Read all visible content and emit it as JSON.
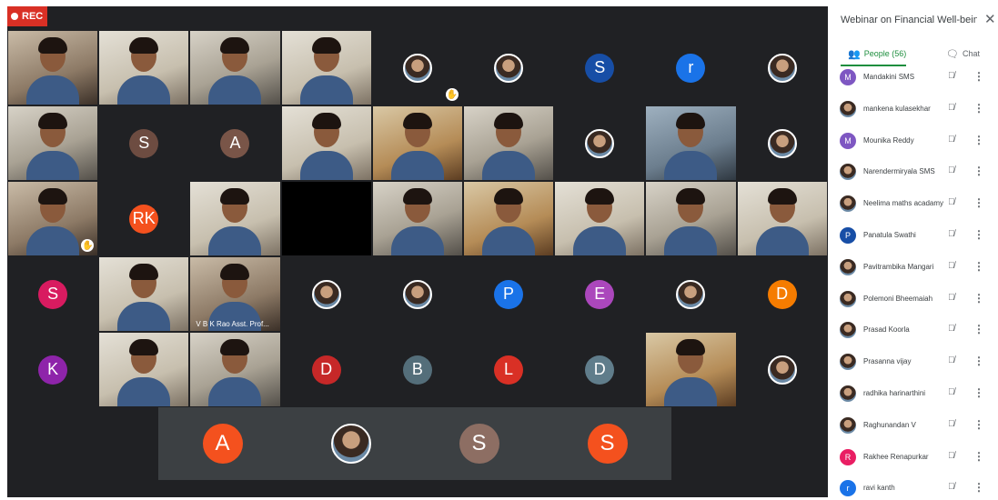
{
  "recording": {
    "label": "REC",
    "color": "#d93025"
  },
  "meeting": {
    "title": "Webinar on Financial Well-being ...",
    "close_icon": "close-icon"
  },
  "tabs": {
    "people_label": "People (56)",
    "chat_label": "Chat",
    "active_color": "#1e8e3e"
  },
  "tiles": [
    {
      "kind": "video",
      "v": "v1"
    },
    {
      "kind": "video",
      "v": "v3"
    },
    {
      "kind": "video",
      "v": "v2"
    },
    {
      "kind": "video",
      "v": "v3"
    },
    {
      "kind": "photo",
      "hand": true
    },
    {
      "kind": "photo"
    },
    {
      "kind": "letter",
      "letter": "S",
      "color": "#174ea6"
    },
    {
      "kind": "letter",
      "letter": "r",
      "color": "#1a73e8"
    },
    {
      "kind": "photo"
    },
    {
      "kind": "video",
      "v": "v2"
    },
    {
      "kind": "letter",
      "letter": "S",
      "color": "#6d4c41"
    },
    {
      "kind": "letter",
      "letter": "A",
      "color": "#795548"
    },
    {
      "kind": "video",
      "v": "v3"
    },
    {
      "kind": "video",
      "v": "v5"
    },
    {
      "kind": "video",
      "v": "v2"
    },
    {
      "kind": "photo"
    },
    {
      "kind": "video",
      "v": "v4"
    },
    {
      "kind": "photo"
    },
    {
      "kind": "video",
      "v": "v1",
      "hand": true
    },
    {
      "kind": "letter",
      "letter": "RK",
      "color": "#f4511e"
    },
    {
      "kind": "video",
      "v": "v3"
    },
    {
      "kind": "black"
    },
    {
      "kind": "video",
      "v": "v2"
    },
    {
      "kind": "video",
      "v": "v5"
    },
    {
      "kind": "video",
      "v": "v3"
    },
    {
      "kind": "video",
      "v": "v2"
    },
    {
      "kind": "video",
      "v": "v3"
    },
    {
      "kind": "letter",
      "letter": "S",
      "color": "#d81b60"
    },
    {
      "kind": "video",
      "v": "v3"
    },
    {
      "kind": "video",
      "v": "v1",
      "name": "V B K Rao Asst. Prof..."
    },
    {
      "kind": "photo"
    },
    {
      "kind": "photo"
    },
    {
      "kind": "letter",
      "letter": "P",
      "color": "#1a73e8"
    },
    {
      "kind": "letter",
      "letter": "E",
      "color": "#ab47bc"
    },
    {
      "kind": "photo"
    },
    {
      "kind": "letter",
      "letter": "D",
      "color": "#f57c00"
    },
    {
      "kind": "letter",
      "letter": "K",
      "color": "#8e24aa"
    },
    {
      "kind": "video",
      "v": "v3"
    },
    {
      "kind": "video",
      "v": "v2"
    },
    {
      "kind": "letter",
      "letter": "D",
      "color": "#c62828"
    },
    {
      "kind": "letter",
      "letter": "B",
      "color": "#546e7a"
    },
    {
      "kind": "letter",
      "letter": "L",
      "color": "#d93025"
    },
    {
      "kind": "letter",
      "letter": "D",
      "color": "#607d8b"
    },
    {
      "kind": "video",
      "v": "v5"
    },
    {
      "kind": "photo"
    }
  ],
  "bottom_tiles": [
    {
      "kind": "letter",
      "letter": "A",
      "color": "#f4511e"
    },
    {
      "kind": "photo"
    },
    {
      "kind": "letter",
      "letter": "S",
      "color": "#8d6e63"
    },
    {
      "kind": "letter",
      "letter": "S",
      "color": "#f4511e"
    }
  ],
  "people": [
    {
      "name": "Mandakini SMS",
      "avatar": "M",
      "color": "#7e57c2"
    },
    {
      "name": "mankena kulasekhar",
      "avatar": "photo"
    },
    {
      "name": "Mounika Reddy",
      "avatar": "M",
      "color": "#7e57c2"
    },
    {
      "name": "Narendermiryala SMS",
      "avatar": "photo"
    },
    {
      "name": "Neelima maths acadamy",
      "avatar": "photo"
    },
    {
      "name": "Panatula Swathi",
      "avatar": "P",
      "color": "#174ea6"
    },
    {
      "name": "Pavitrambika Mangari",
      "avatar": "photo"
    },
    {
      "name": "Polemoni Bheemaiah",
      "avatar": "photo"
    },
    {
      "name": "Prasad Koorla",
      "avatar": "photo"
    },
    {
      "name": "Prasanna vijay",
      "avatar": "photo"
    },
    {
      "name": "radhika harinarthini",
      "avatar": "photo"
    },
    {
      "name": "Raghunandan V",
      "avatar": "photo"
    },
    {
      "name": "Rakhee Renapurkar",
      "avatar": "R",
      "color": "#e91e63"
    },
    {
      "name": "ravi kanth",
      "avatar": "r",
      "color": "#1a73e8"
    }
  ]
}
